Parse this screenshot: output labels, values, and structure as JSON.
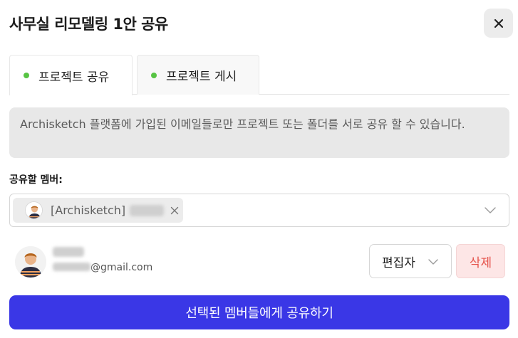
{
  "dialog": {
    "title": "사무실 리모델링 1안 공유"
  },
  "tabs": [
    {
      "label": "프로젝트 공유",
      "active": true
    },
    {
      "label": "프로젝트 게시",
      "active": false
    }
  ],
  "notice": {
    "text": "Archisketch 플랫폼에 가입된 이메일들로만 프로젝트 또는 폴더를 서로 공유 할 수 있습니다."
  },
  "member_select": {
    "label": "공유할 멤버:",
    "chip_label": "[Archisketch]"
  },
  "member": {
    "email_domain": "@gmail.com",
    "role": "편집자",
    "delete_label": "삭제"
  },
  "actions": {
    "share_label": "선택된 멤버들에게 공유하기"
  },
  "colors": {
    "accent": "#3a37e6",
    "status_dot": "#57c443",
    "danger": "#e5534b",
    "danger_bg": "#fde6e6"
  },
  "icons": [
    "close-icon",
    "chevron-down-icon",
    "remove-chip-icon",
    "avatar"
  ]
}
